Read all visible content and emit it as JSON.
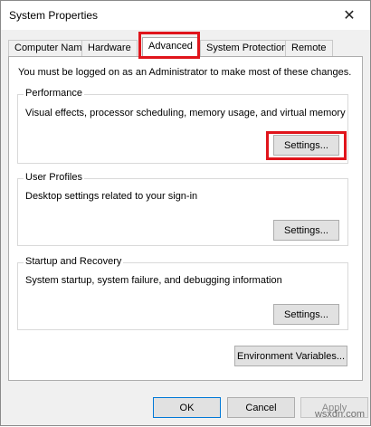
{
  "window": {
    "title": "System Properties",
    "close_glyph": "✕"
  },
  "tabs": [
    {
      "label": "Computer Name",
      "active": false
    },
    {
      "label": "Hardware",
      "active": false
    },
    {
      "label": "Advanced",
      "active": true
    },
    {
      "label": "System Protection",
      "active": false
    },
    {
      "label": "Remote",
      "active": false
    }
  ],
  "advanced": {
    "admin_note": "You must be logged on as an Administrator to make most of these changes.",
    "performance": {
      "title": "Performance",
      "description": "Visual effects, processor scheduling, memory usage, and virtual memory",
      "button": "Settings..."
    },
    "user_profiles": {
      "title": "User Profiles",
      "description": "Desktop settings related to your sign-in",
      "button": "Settings..."
    },
    "startup_recovery": {
      "title": "Startup and Recovery",
      "description": "System startup, system failure, and debugging information",
      "button": "Settings..."
    },
    "env_button": "Environment Variables..."
  },
  "dialog_buttons": {
    "ok": "OK",
    "cancel": "Cancel",
    "apply": "Apply"
  },
  "watermark": "wsxdn.com",
  "colors": {
    "highlight": "#e0141b",
    "default_button_border": "#0078d7"
  }
}
